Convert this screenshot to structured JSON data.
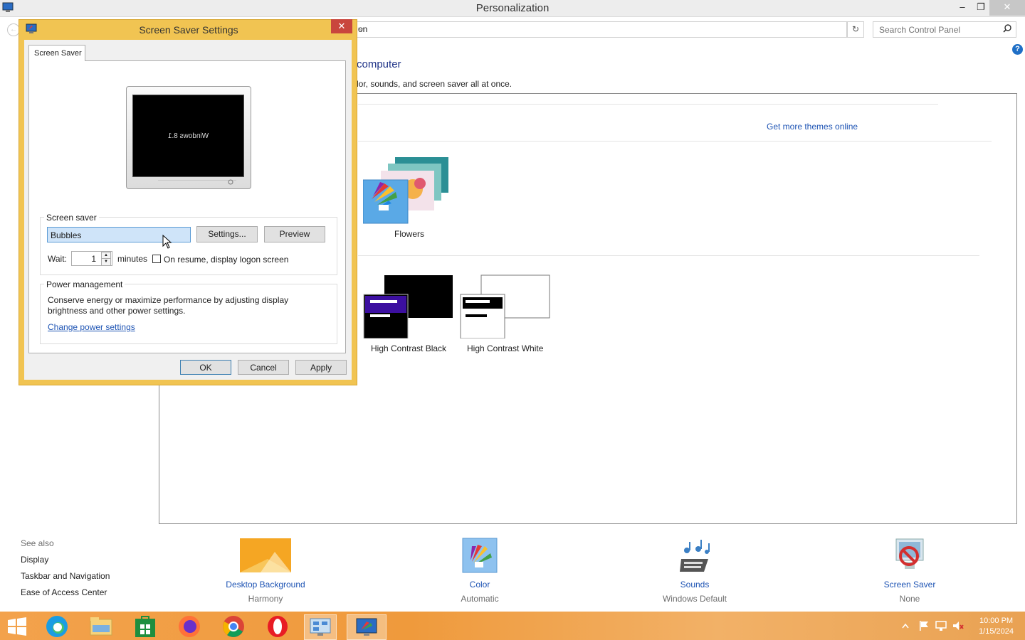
{
  "window": {
    "title": "Personalization",
    "minimize": "–",
    "restore": "❐",
    "close": "✕"
  },
  "address": {
    "text": "on",
    "dropdown_arrow": "⌵"
  },
  "search": {
    "placeholder": "Search Control Panel"
  },
  "help": "?",
  "main": {
    "heading": "computer",
    "subheading": "lor, sounds, and screen saver all at once.",
    "get_more_themes": "Get more themes online",
    "themes": [
      {
        "label": "Flowers"
      },
      {
        "label": "High Contrast Black"
      },
      {
        "label": "High Contrast White"
      }
    ]
  },
  "see_also": {
    "title": "See also",
    "links": [
      "Display",
      "Taskbar and Navigation",
      "Ease of Access Center"
    ]
  },
  "bottom": [
    {
      "label": "Desktop Background",
      "sub": "Harmony"
    },
    {
      "label": "Color",
      "sub": "Automatic"
    },
    {
      "label": "Sounds",
      "sub": "Windows Default"
    },
    {
      "label": "Screen Saver",
      "sub": "None"
    }
  ],
  "dialog": {
    "title": "Screen Saver Settings",
    "close": "✕",
    "tab": "Screen Saver",
    "preview_text": "Windows 8.1",
    "screen_saver_group": "Screen saver",
    "screen_saver_value": "Bubbles",
    "settings_button": "Settings...",
    "preview_button": "Preview",
    "wait_label": "Wait:",
    "wait_value": "1",
    "minutes_label": "minutes",
    "resume_label": "On resume, display logon screen",
    "resume_checked": false,
    "power_group": "Power management",
    "power_text": "Conserve energy or maximize performance by adjusting display brightness and other power settings.",
    "power_link": "Change power settings",
    "ok": "OK",
    "cancel": "Cancel",
    "apply": "Apply"
  },
  "taskbar": {
    "apps": [
      "start",
      "edge",
      "file-explorer",
      "store",
      "firefox",
      "chrome",
      "opera",
      "control-panel",
      "personalization"
    ],
    "time": "10:00 PM",
    "date": "1/15/2024"
  },
  "colors": {
    "accent": "#f1c452",
    "link": "#1e54b4",
    "taskbar": "#ef9a3c"
  }
}
